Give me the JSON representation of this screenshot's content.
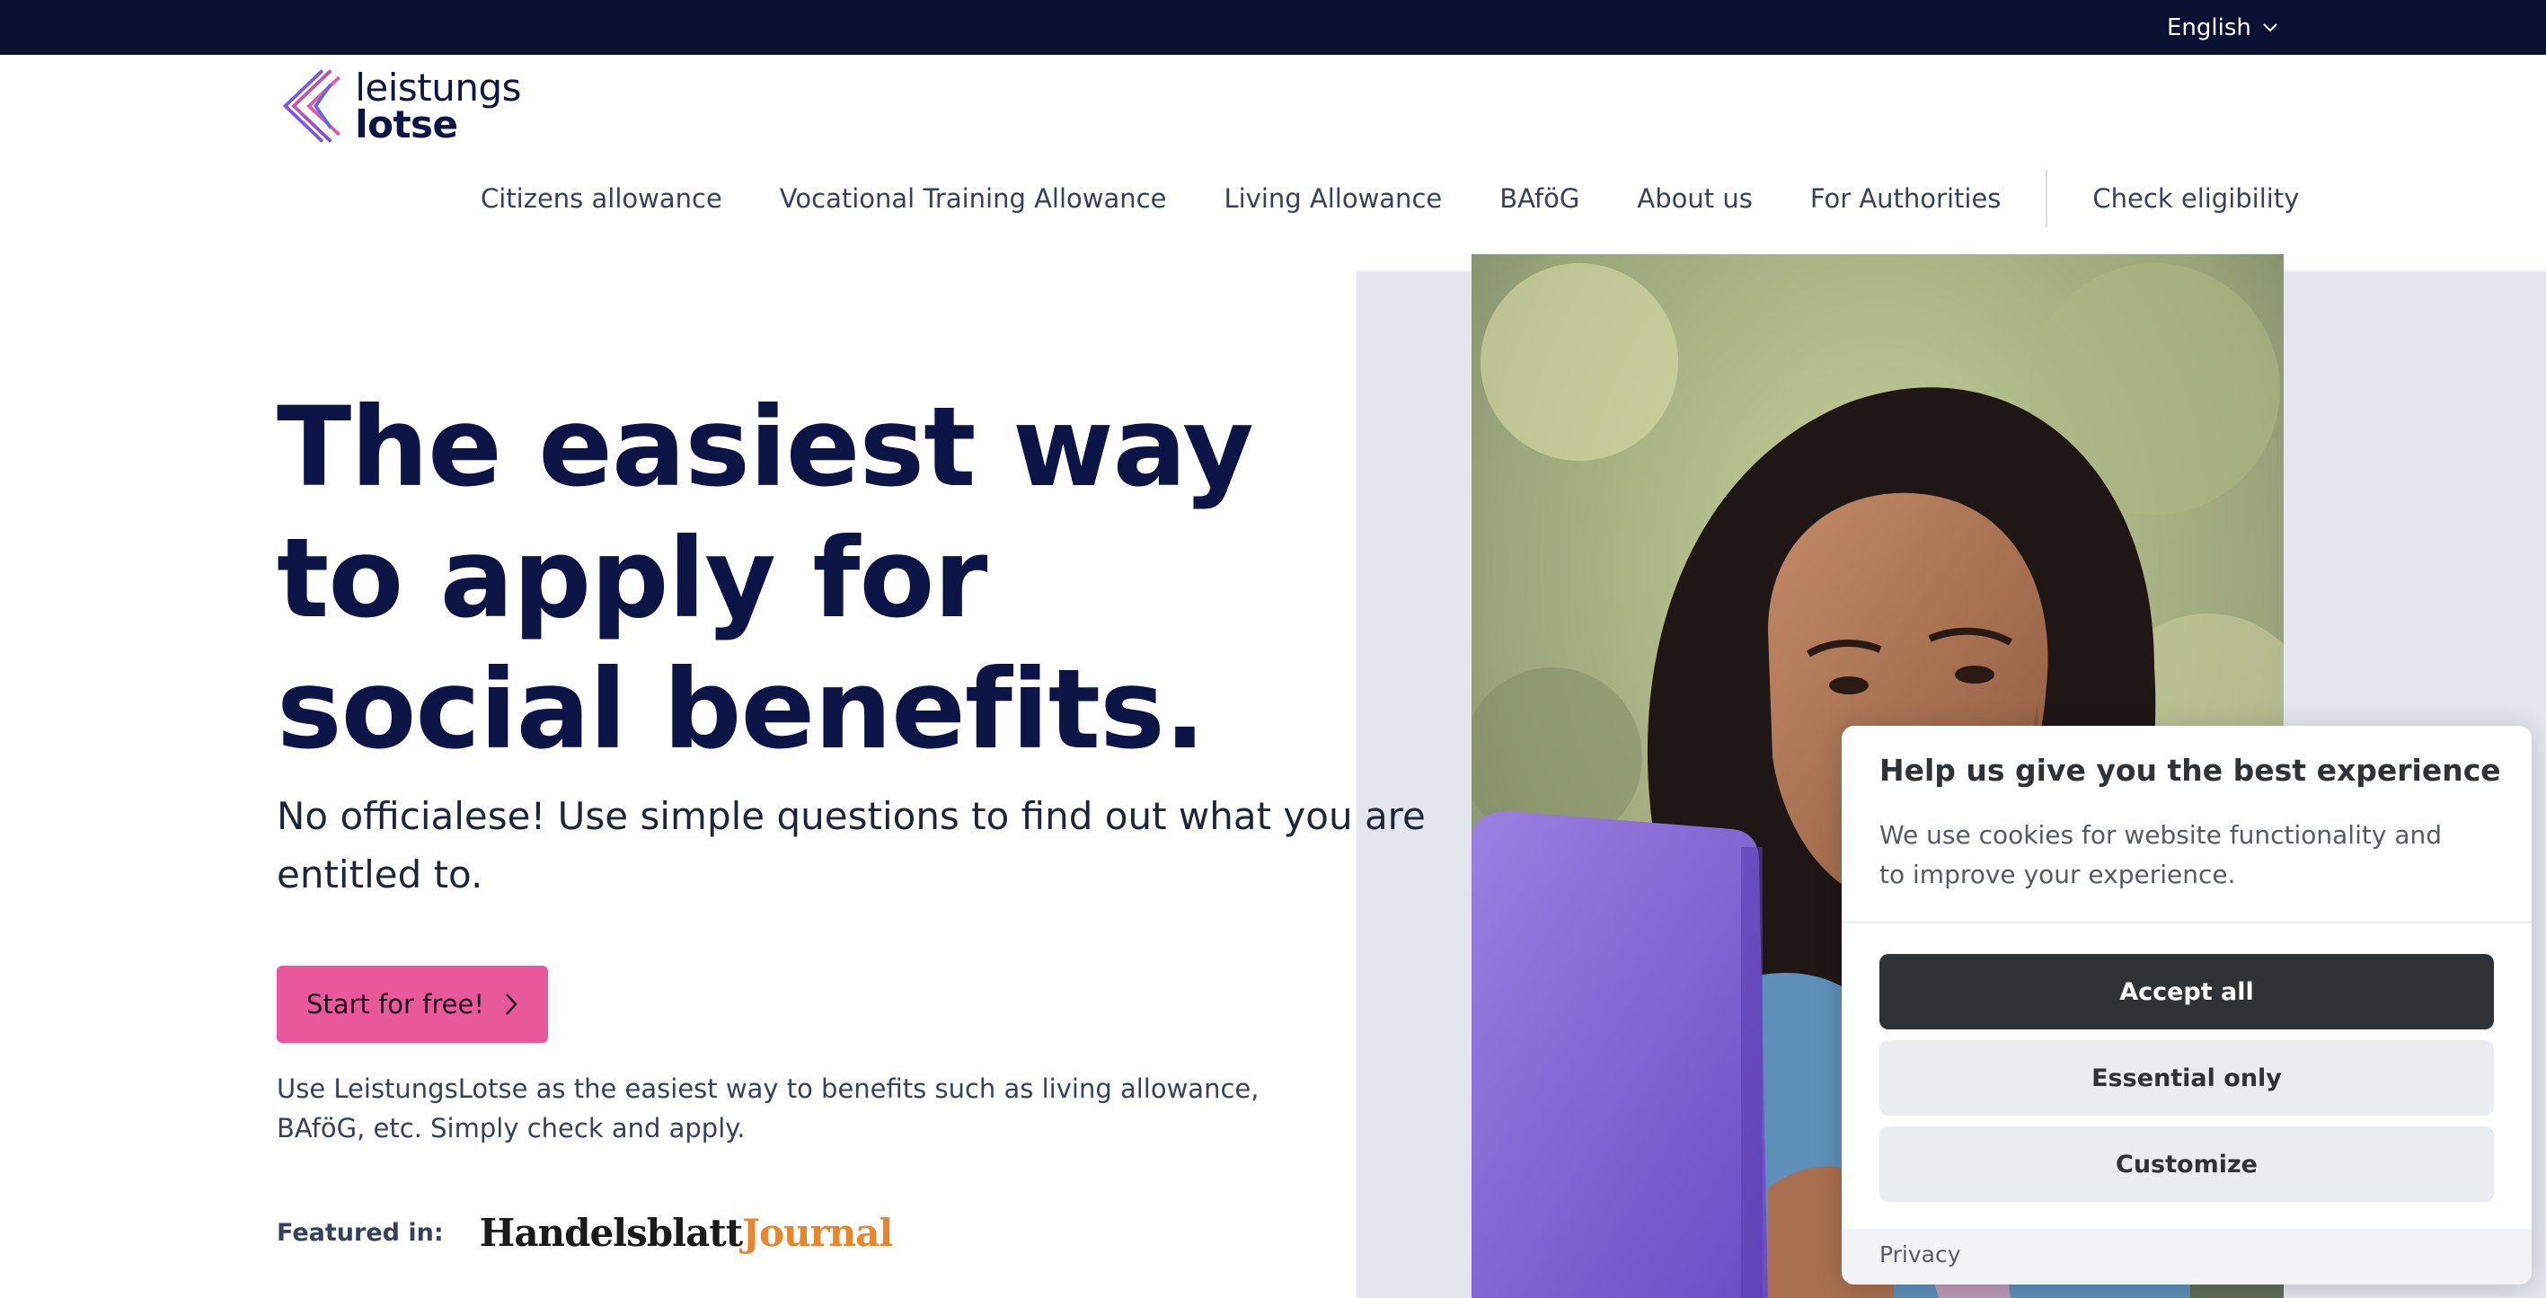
{
  "topbar": {
    "language": "English",
    "language_icon": "chevron-down-icon"
  },
  "header": {
    "logo_line1": "leistungs",
    "logo_line2": "lotse",
    "nav": [
      {
        "label": "Citizens allowance"
      },
      {
        "label": "Vocational Training Allowance"
      },
      {
        "label": "Living Allowance"
      },
      {
        "label": "BAföG"
      },
      {
        "label": "About us"
      },
      {
        "label": "For Authorities"
      }
    ],
    "check_eligibility": "Check eligibility"
  },
  "hero": {
    "headline": "The easiest way to apply for social benefits.",
    "subhead": "No officialese! Use simple questions to find out what you are entitled to.",
    "cta_label": "Start for free!",
    "description": "Use LeistungsLotse as the easiest way to benefits such as living allowance, BAföG, etc. Simply check and apply.",
    "featured_label": "Featured in:",
    "press_name_part1": "Handelsblatt",
    "press_name_part2": "Journal"
  },
  "cookie_banner": {
    "title": "Help us give you the best experience",
    "text": "We use cookies for website functionality and to improve your experience.",
    "accept_label": "Accept all",
    "essential_label": "Essential only",
    "customize_label": "Customize",
    "privacy_label": "Privacy"
  },
  "colors": {
    "topbar": "#0a1133",
    "brand_navy": "#0d1446",
    "cta_pink": "#e9589b",
    "hero_panel": "#e4e6ee",
    "cookie_dark": "#2f3336",
    "press_orange": "#e8862b"
  }
}
